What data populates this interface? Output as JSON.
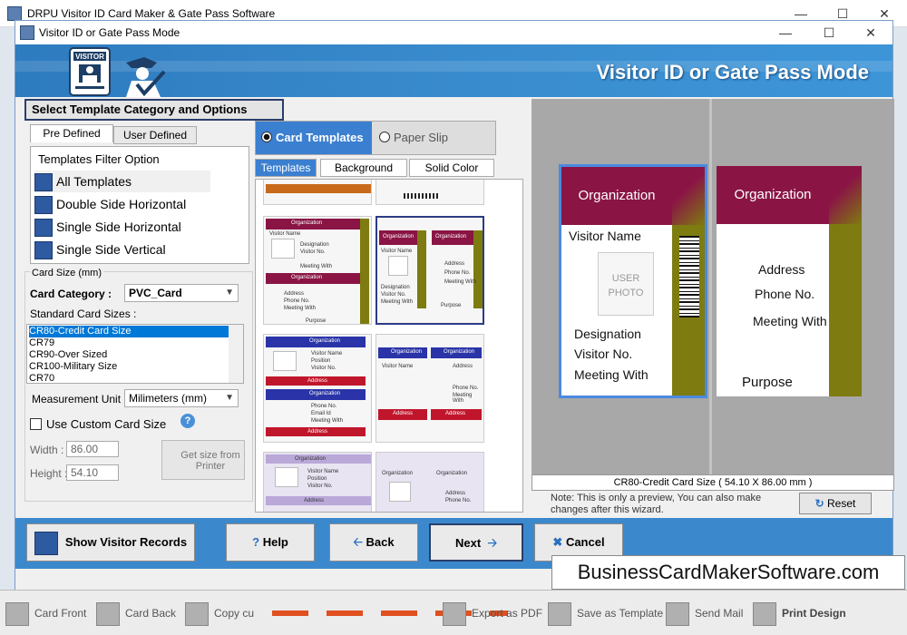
{
  "app": {
    "title": "DRPU Visitor ID Card Maker & Gate Pass Software",
    "minimize": "—",
    "maximize": "☐",
    "close": "✕"
  },
  "dialog": {
    "title": "Visitor ID or Gate Pass Mode",
    "banner_title": "Visitor ID or Gate Pass Mode",
    "banner_logo_text": "VISITOR"
  },
  "left_panel": {
    "section_title": "Select Template Category and Options",
    "tabs": [
      {
        "label": "Pre Defined",
        "active": true
      },
      {
        "label": "User Defined",
        "active": false
      }
    ],
    "filter_header": "Templates Filter Option",
    "filter_items": [
      {
        "label": "All Templates",
        "selected": true
      },
      {
        "label": "Double Side Horizontal",
        "selected": false
      },
      {
        "label": "Single Side Horizontal",
        "selected": false
      },
      {
        "label": "Single Side Vertical",
        "selected": false
      }
    ],
    "card_size_group": "Card Size (mm)",
    "card_category_label": "Card Category :",
    "card_category_value": "PVC_Card",
    "standard_sizes_label": "Standard Card Sizes :",
    "standard_sizes": [
      {
        "label": "CR80-Credit Card Size",
        "selected": true
      },
      {
        "label": "CR79",
        "selected": false
      },
      {
        "label": "CR90-Over Sized",
        "selected": false
      },
      {
        "label": "CR100-Military Size",
        "selected": false
      },
      {
        "label": "CR70",
        "selected": false
      }
    ],
    "measurement_label": "Measurement Unit :",
    "measurement_value": "Milimeters (mm)",
    "custom_size_label": "Use Custom Card Size",
    "width_label": "Width :",
    "width_value": "86.00",
    "height_label": "Height :",
    "height_value": "54.10",
    "get_size_button": "Get size from Printer"
  },
  "middle_panel": {
    "mode_card": "Card Templates",
    "mode_paper": "Paper Slip",
    "subtabs": [
      "Templates",
      "Background",
      "Solid Color"
    ],
    "thumb_texts": {
      "organization": "Organization",
      "visitor_name": "Visitor Name",
      "designation": "Designation",
      "visitor_no": "Visitor No.",
      "meeting_with": "Meeting With",
      "address": "Address",
      "phone_no": "Phone No.",
      "purpose": "Purpose",
      "user_photo": "USER PHOTO",
      "position": "Position",
      "email_id": "Email Id"
    }
  },
  "preview": {
    "front": {
      "organization": "Organization",
      "visitor_name": "Visitor Name",
      "user_photo": "USER PHOTO",
      "designation": "Designation",
      "visitor_no": "Visitor No.",
      "meeting_with": "Meeting With"
    },
    "back": {
      "organization": "Organization",
      "address": "Address",
      "phone_no": "Phone No.",
      "meeting_with": "Meeting With",
      "purpose": "Purpose"
    },
    "size_caption": "CR80-Credit Card Size ( 54.10 X 86.00 mm )",
    "note": "Note: This is only a preview, You can also make changes after this wizard.",
    "reset_button": "Reset"
  },
  "buttons": {
    "show_records": "Show Visitor Records",
    "help": "Help",
    "back": "Back",
    "next": "Next",
    "cancel": "Cancel"
  },
  "watermark": "BusinessCardMakerSoftware.com",
  "bottom_toolbar": [
    "Card Front",
    "Card Back",
    "Copy cu",
    "Export as PDF",
    "Save as Template",
    "Send Mail",
    "Print Design"
  ],
  "colors": {
    "banner": "#3a8ed0",
    "org_band": "#8a1545",
    "olive": "#7e7b10",
    "selection": "#0078d7"
  }
}
